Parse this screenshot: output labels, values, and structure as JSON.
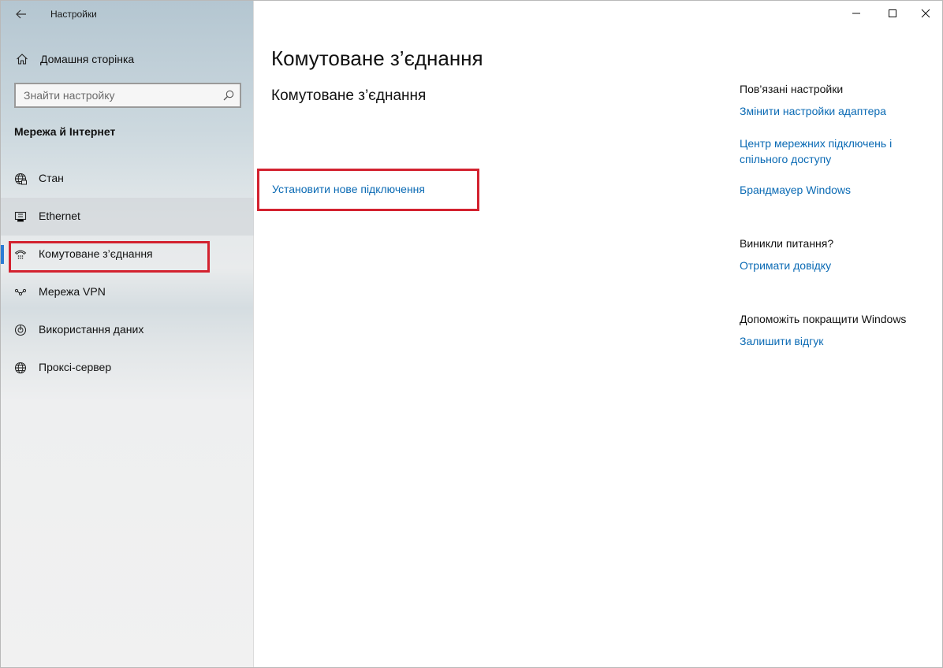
{
  "app": {
    "title": "Настройки"
  },
  "sidebar": {
    "home_label": "Домашня сторінка",
    "search_placeholder": "Знайти настройку",
    "section_heading": "Мережа й Інтернет",
    "items": [
      {
        "label": "Стан",
        "icon": "globe-status-icon"
      },
      {
        "label": "Ethernet",
        "icon": "ethernet-icon"
      },
      {
        "label": "Комутоване з’єднання",
        "icon": "dialup-phone-icon",
        "selected": true
      },
      {
        "label": "Мережа VPN",
        "icon": "vpn-icon"
      },
      {
        "label": "Використання даних",
        "icon": "data-usage-icon"
      },
      {
        "label": "Проксі-сервер",
        "icon": "globe-icon"
      }
    ]
  },
  "main": {
    "title": "Комутоване з’єднання",
    "subheading": "Комутоване з’єднання",
    "setup_link": "Установити нове підключення"
  },
  "related": {
    "heading": "Пов’язані настройки",
    "links": [
      "Змінити настройки адаптера",
      "Центр мережних підключень і спільного доступу",
      "Брандмауер Windows"
    ],
    "questions_heading": "Виникли питання?",
    "help_link": "Отримати довідку",
    "feedback_heading": "Допоможіть покращити Windows",
    "feedback_link": "Залишити відгук"
  },
  "colors": {
    "accent": "#2b7bd4",
    "link": "#0a6ab4",
    "highlight": "#d3222f"
  }
}
